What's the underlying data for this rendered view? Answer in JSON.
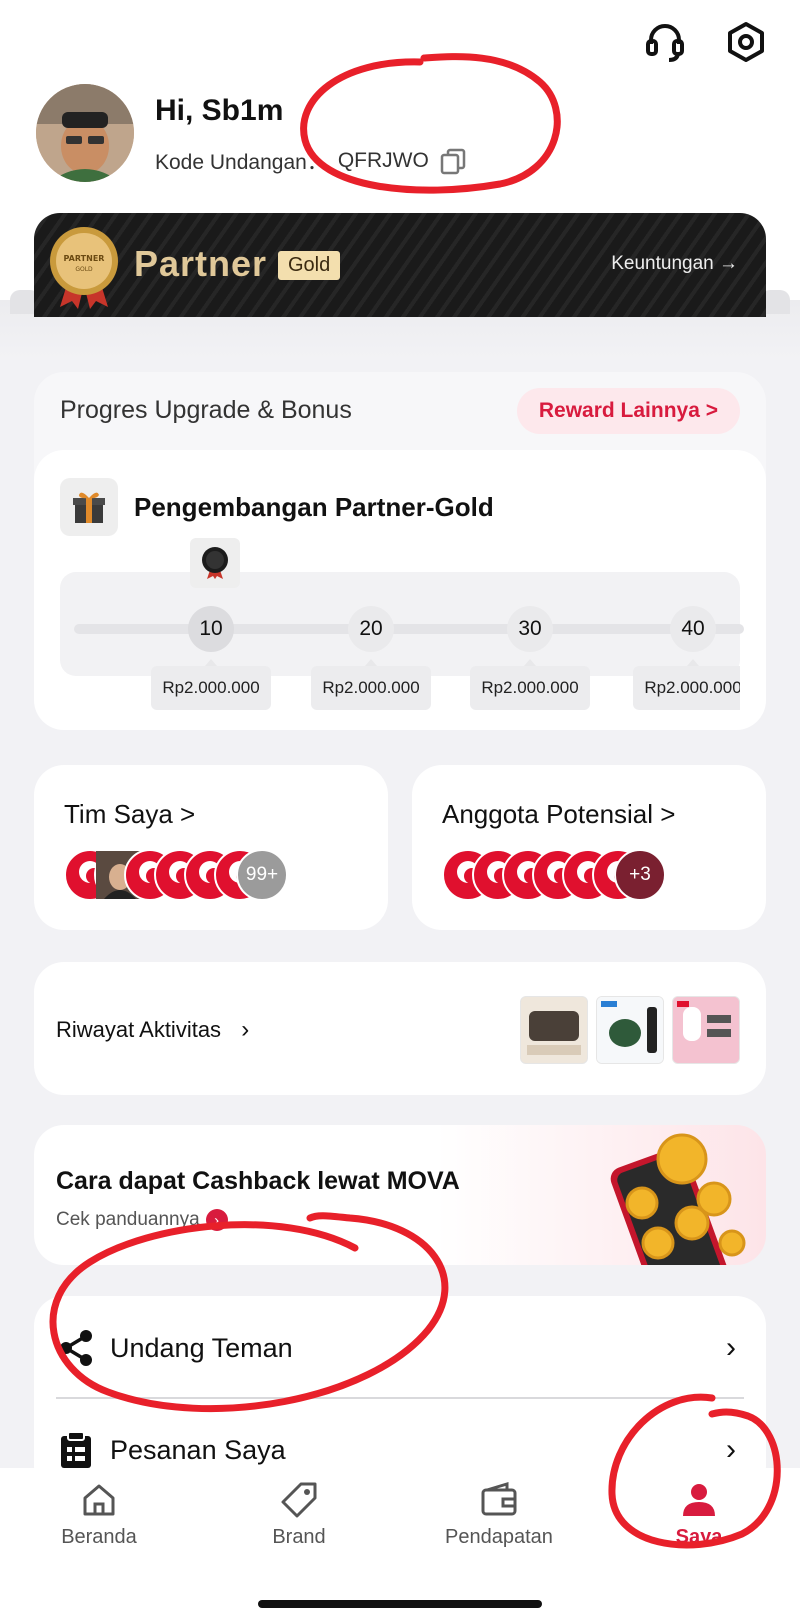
{
  "header": {
    "greeting": "Hi, Sb1m",
    "invite_label": "Kode Undangan：",
    "invite_code": "QFRJWO"
  },
  "partner": {
    "title": "Partner",
    "tier": "Gold",
    "benefits_link": "Keuntungan →",
    "medal_text_top": "PARTNER",
    "medal_text_bottom": "GOLD"
  },
  "progress": {
    "title": "Progres Upgrade & Bonus",
    "reward_button": "Reward Lainnya  >",
    "dev_title": "Pengembangan Partner-Gold",
    "steps": [
      {
        "level": "10",
        "amount": "Rp2.000.000"
      },
      {
        "level": "20",
        "amount": "Rp2.000.000"
      },
      {
        "level": "30",
        "amount": "Rp2.000.000"
      },
      {
        "level": "40",
        "amount": "Rp2.000.000"
      }
    ]
  },
  "team": {
    "title": "Tim Saya  >",
    "count_badge": "99+"
  },
  "potential": {
    "title": "Anggota Potensial  >",
    "count_badge": "+3"
  },
  "activity": {
    "title": "Riwayat Aktivitas"
  },
  "cashback": {
    "title": "Cara dapat Cashback lewat MOVA",
    "subtitle": "Cek panduannya"
  },
  "menu": {
    "items": [
      {
        "label": "Undang Teman"
      },
      {
        "label": "Pesanan Saya"
      }
    ]
  },
  "tabbar": {
    "tabs": [
      {
        "label": "Beranda"
      },
      {
        "label": "Brand"
      },
      {
        "label": "Pendapatan"
      },
      {
        "label": "Saya"
      }
    ]
  },
  "colors": {
    "accent": "#d81b3e",
    "gold": "#e0c899",
    "annotation": "#e8202a"
  }
}
